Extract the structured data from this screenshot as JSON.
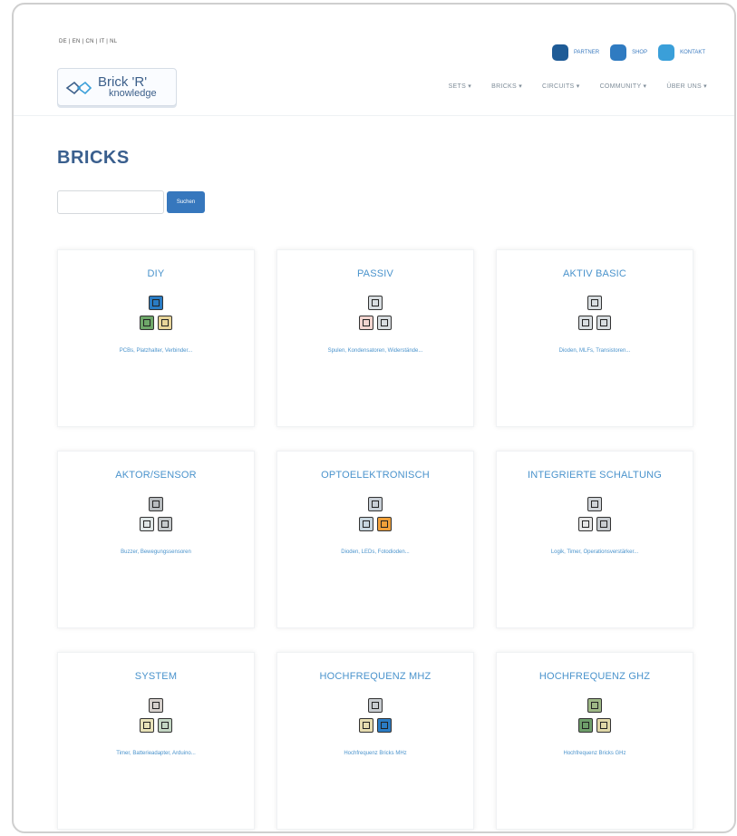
{
  "header": {
    "languages": "DE | EN | CN | IT | NL",
    "top_links": [
      {
        "label": "PARTNER",
        "color": "#1e5b96"
      },
      {
        "label": "SHOP",
        "color": "#2f7bc1"
      },
      {
        "label": "KONTAKT",
        "color": "#3a9fd9"
      }
    ],
    "logo": {
      "line1": "Brick 'R'",
      "line2": "knowledge"
    },
    "nav": [
      "SETS ▾",
      "BRICKS ▾",
      "CIRCUITS ▾",
      "COMMUNITY ▾",
      "ÜBER UNS ▾"
    ]
  },
  "page": {
    "title": "BRICKS",
    "search_placeholder": "",
    "search_button": "Suchen"
  },
  "cards": [
    {
      "title": "DIY",
      "desc": "PCBs, Platzhalter, Verbinder...",
      "colors": [
        "#2a7cc4",
        "#6fa86a",
        "#e8d59a"
      ]
    },
    {
      "title": "PASSIV",
      "desc": "Spulen, Kondensatoren, Widerstände...",
      "colors": [
        "#d8dde0",
        "#f3d5d0",
        "#d8dde0"
      ]
    },
    {
      "title": "AKTIV BASIC",
      "desc": "Dioden, MLFs, Transistoren...",
      "colors": [
        "#d8dde0",
        "#d8dde0",
        "#d8dde0"
      ]
    },
    {
      "title": "AKTOR/SENSOR",
      "desc": "Buzzer, Bewegungssensoren",
      "colors": [
        "#b8bcbf",
        "#dfe6e6",
        "#c6cacc"
      ]
    },
    {
      "title": "OPTOELEKTRONISCH",
      "desc": "Dioden, LEDs, Fotodioden...",
      "colors": [
        "#c8cfd6",
        "#c8d6df",
        "#f0a03a"
      ]
    },
    {
      "title": "INTEGRIERTE SCHALTUNG",
      "desc": "Logik, Timer, Operationsverstärker...",
      "colors": [
        "#d0d4d8",
        "#e6e6e6",
        "#c8ccd0"
      ]
    },
    {
      "title": "SYSTEM",
      "desc": "Timer, Batterieadapter, Arduino...",
      "colors": [
        "#d6d0cc",
        "#e8e2b8",
        "#c3d6c3"
      ]
    },
    {
      "title": "HOCHFREQUENZ MHZ",
      "desc": "Hochfrequenz Bricks MHz",
      "colors": [
        "#c8ccd0",
        "#e6dcb0",
        "#2a7cc4"
      ]
    },
    {
      "title": "HOCHFREQUENZ GHZ",
      "desc": "Hochfrequenz Bricks GHz",
      "colors": [
        "#9eb886",
        "#6e9e6a",
        "#e0d8a8"
      ]
    }
  ]
}
